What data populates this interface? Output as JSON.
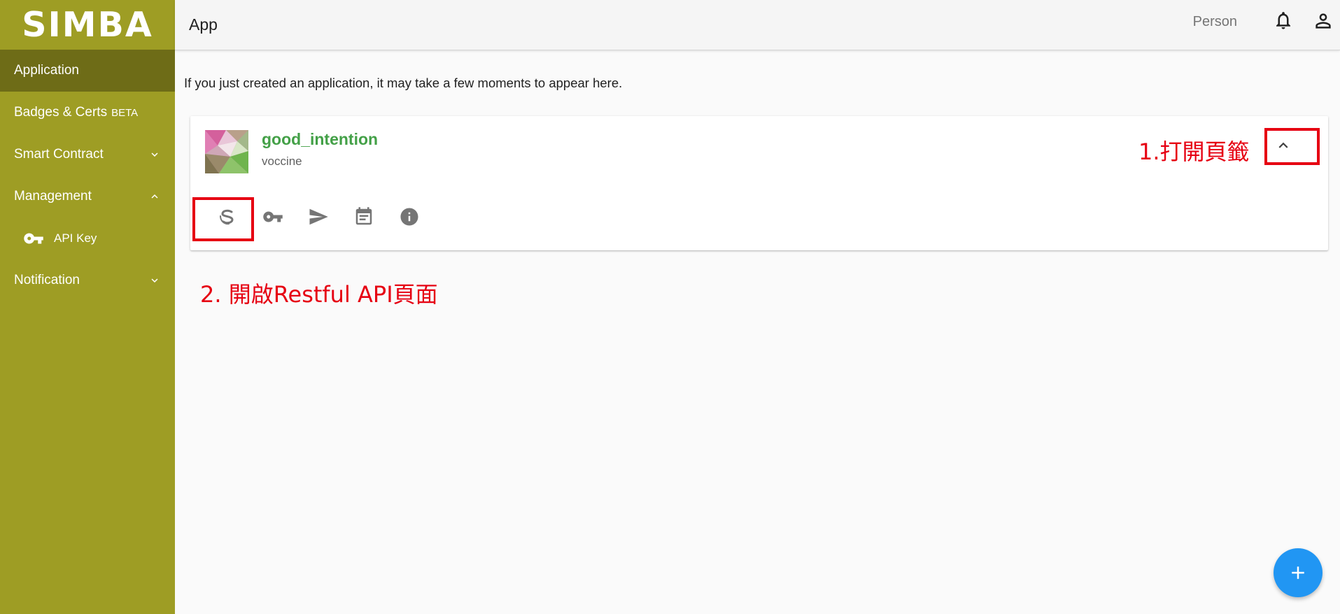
{
  "sidebar": {
    "logo": "SIMBA",
    "items": [
      {
        "label": "Application"
      },
      {
        "label": "Badges & Certs",
        "badge": "BETA"
      },
      {
        "label": "Smart Contract"
      },
      {
        "label": "Management"
      },
      {
        "label": "API Key"
      },
      {
        "label": "Notification"
      }
    ]
  },
  "header": {
    "title": "App",
    "user": "Person"
  },
  "main": {
    "info": "If you just created an application, it may take a few moments to appear here.",
    "card": {
      "name": "good_intention",
      "subtitle": "voccine",
      "actions": [
        "simba-logo-icon",
        "key-icon",
        "send-icon",
        "calendar-icon",
        "info-icon"
      ]
    }
  },
  "annotations": {
    "step1": "1.打開頁籤",
    "step2": "2. 開啟Restful API頁面",
    "color": "#e60012"
  },
  "colors": {
    "sidebar": "#9e9d24",
    "sidebar_active": "#6e6c17",
    "app_name": "#43a047",
    "fab": "#2196f3"
  }
}
